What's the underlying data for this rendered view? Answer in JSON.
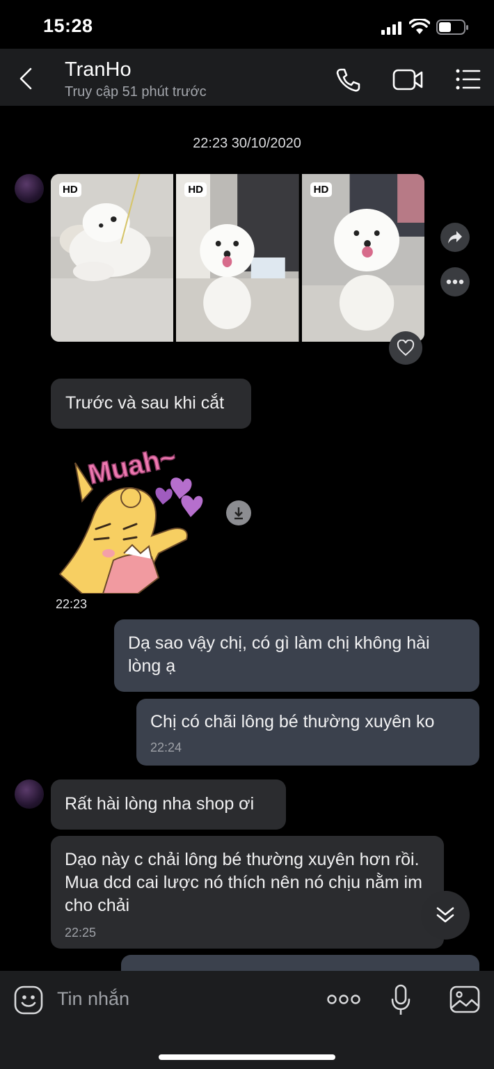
{
  "status_bar": {
    "time": "15:28"
  },
  "header": {
    "name": "TranHo",
    "subtitle": "Truy cập 51 phút trước"
  },
  "conversation": {
    "date_separator": "22:23 30/10/2020",
    "photos": [
      {
        "badge": "HD"
      },
      {
        "badge": "HD"
      },
      {
        "badge": "HD"
      }
    ],
    "messages": [
      {
        "text": "Trước và sau khi cắt"
      },
      {
        "sticker_text": "Muah~",
        "time": "22:23"
      },
      {
        "text": "Dạ sao vậy chị, có gì làm chị không hài lòng ạ"
      },
      {
        "text": "Chị có chãi lông bé thường xuyên ko",
        "time": "22:24"
      },
      {
        "text": "Rất hài lòng nha shop ơi"
      },
      {
        "text": "Dạo này c chải lông bé thường xuyên hơn rồi. Mua dcd cai lược nó thích nên nó chịu nằm im cho chải",
        "time": "22:25"
      }
    ]
  },
  "composer": {
    "placeholder": "Tin nhắn"
  },
  "icons": {
    "back": "chevron-left-icon",
    "call": "phone-icon",
    "video": "video-camera-icon",
    "menu": "list-menu-icon",
    "share": "share-icon",
    "more": "more-horizontal-icon",
    "react": "heart-icon",
    "download": "download-icon",
    "scroll": "double-chevron-down-icon",
    "emoji": "emoji-icon",
    "options": "more-dots-icon",
    "mic": "microphone-icon",
    "gallery": "image-icon"
  },
  "colors": {
    "background": "#000000",
    "incoming_bubble": "#2b2c2f",
    "outgoing_bubble": "#3b414d",
    "header": "#1c1d1f"
  }
}
